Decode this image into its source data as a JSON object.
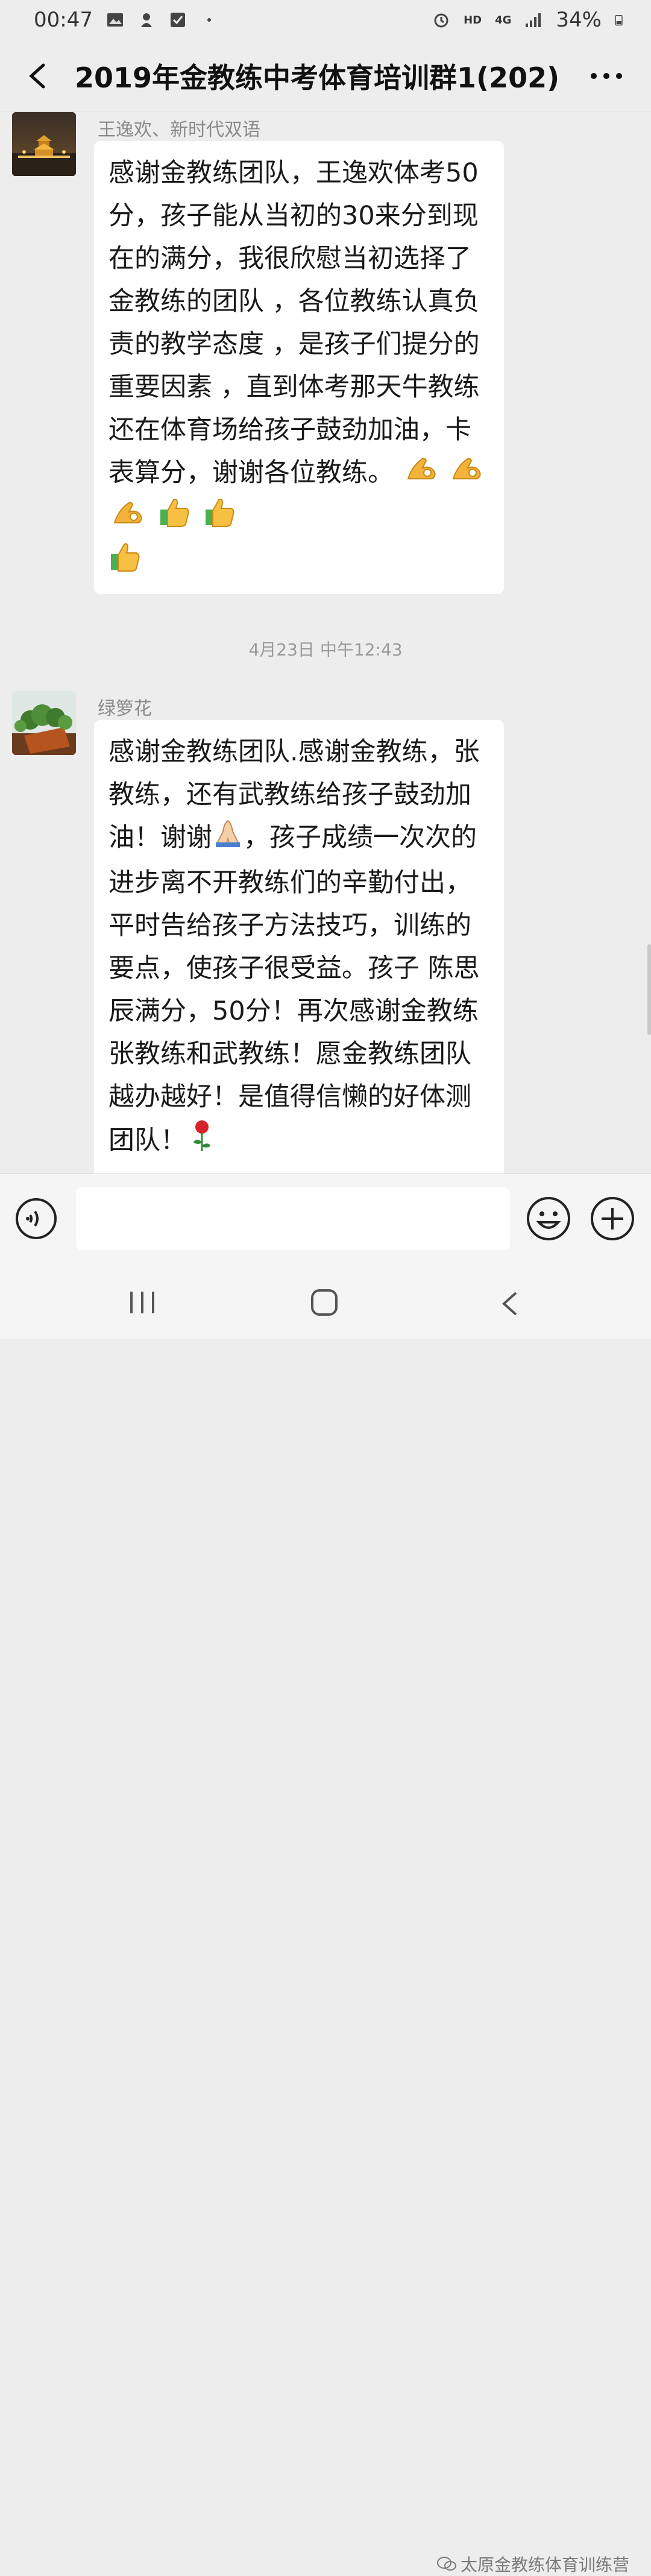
{
  "status_bar": {
    "time": "00:47",
    "network_hd": "HD",
    "network_4g": "4G",
    "battery": "34%"
  },
  "header": {
    "back_icon": "chevron-left-icon",
    "title": "2019年金教练中考体育培训群1(202)",
    "more_icon": "more-icon"
  },
  "messages": [
    {
      "sender": "王逸欢、新时代双语",
      "avatar_icon": "avatar-pagoda",
      "text": "感谢金教练团队，王逸欢体考50分，孩子能从当初的30来分到现在的满分，我很欣慰当初选择了金教练的团队 ，各位教练认真负责的教学态度 ，是孩子们提分的重要因素 ，直到体考那天牛教练还在体育场给孩子鼓劲加油，卡表算分，谢谢各位教练。",
      "emojis": [
        "ok-hand",
        "ok-hand",
        "ok-hand",
        "thumbs-up",
        "thumbs-up",
        "thumbs-up"
      ]
    },
    {
      "sender": "绿箩花",
      "avatar_icon": "avatar-plant",
      "text_before_emoji": "感谢金教练团队.感谢金教练，张教练，还有武教练给孩子鼓劲加油！谢谢",
      "text_after_emoji": "，孩子成绩一次次的进步离不开教练们的辛勤付出，平时告给孩子方法技巧，训练的要点，使孩子很受益。孩子 陈思辰满分，50分！再次感谢金教练张教练和武教练！愿金教练团队越办越好！是值得信懒的好体测团队！",
      "emojis": [
        "praying-hands",
        "rose"
      ]
    }
  ],
  "timestamp": "4月23日 中午12:43",
  "input_bar": {
    "voice_icon": "voice-icon",
    "emoji_icon": "smiley-icon",
    "plus_icon": "plus-icon"
  },
  "watermark": "太原金教练体育训练营",
  "colors": {
    "background": "#ededed",
    "bubble": "#ffffff",
    "sender": "#8a8a8a"
  }
}
